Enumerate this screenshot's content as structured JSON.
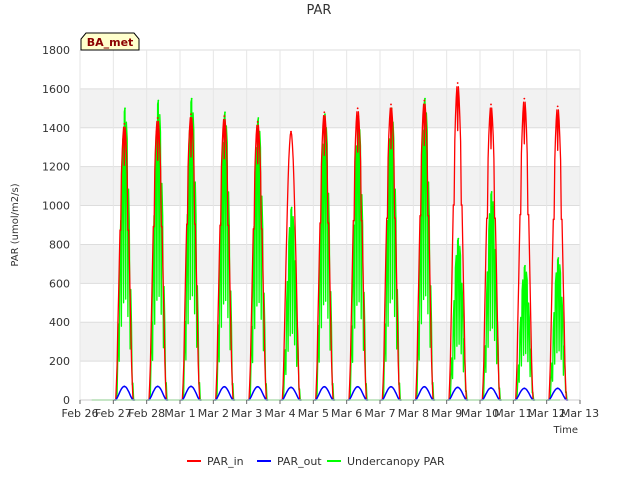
{
  "chart_data": {
    "type": "line",
    "title": "PAR",
    "xlabel": "Time",
    "ylabel": "PAR (umol/m2/s)",
    "ylim": [
      0,
      1800
    ],
    "yticks": [
      0,
      200,
      400,
      600,
      800,
      1000,
      1200,
      1400,
      1600,
      1800
    ],
    "xlim": [
      0,
      15
    ],
    "xticks": [
      {
        "pos": 0,
        "label": "Feb 26"
      },
      {
        "pos": 1,
        "label": "Feb 27"
      },
      {
        "pos": 2,
        "label": "Feb 28"
      },
      {
        "pos": 3,
        "label": "Mar 1"
      },
      {
        "pos": 4,
        "label": "Mar 2"
      },
      {
        "pos": 5,
        "label": "Mar 3"
      },
      {
        "pos": 6,
        "label": "Mar 4"
      },
      {
        "pos": 7,
        "label": "Mar 5"
      },
      {
        "pos": 8,
        "label": "Mar 6"
      },
      {
        "pos": 9,
        "label": "Mar 7"
      },
      {
        "pos": 10,
        "label": "Mar 8"
      },
      {
        "pos": 11,
        "label": "Mar 9"
      },
      {
        "pos": 12,
        "label": "Mar 10"
      },
      {
        "pos": 13,
        "label": "Mar 11"
      },
      {
        "pos": 14,
        "label": "Mar 12"
      },
      {
        "pos": 15,
        "label": "Mar 13"
      }
    ],
    "grid": true,
    "legend_position": "bottom",
    "annotation": "BA_met",
    "series": [
      {
        "name": "PAR_in",
        "color": "#ff0000",
        "daily_peaks": [
          1420,
          1450,
          1470,
          1460,
          1430,
          1380,
          1480,
          1500,
          1520,
          1540,
          1630,
          1520,
          1550,
          1510
        ]
      },
      {
        "name": "PAR_out",
        "color": "#0000ff",
        "daily_peaks": [
          70,
          70,
          70,
          68,
          68,
          65,
          68,
          68,
          68,
          68,
          65,
          62,
          60,
          60
        ]
      },
      {
        "name": "Undercanopy PAR",
        "color": "#00ff00",
        "daily_peaks": [
          1500,
          1540,
          1550,
          1480,
          1450,
          990,
          1470,
          1460,
          1500,
          1550,
          830,
          1070,
          690,
          730
        ]
      }
    ]
  }
}
